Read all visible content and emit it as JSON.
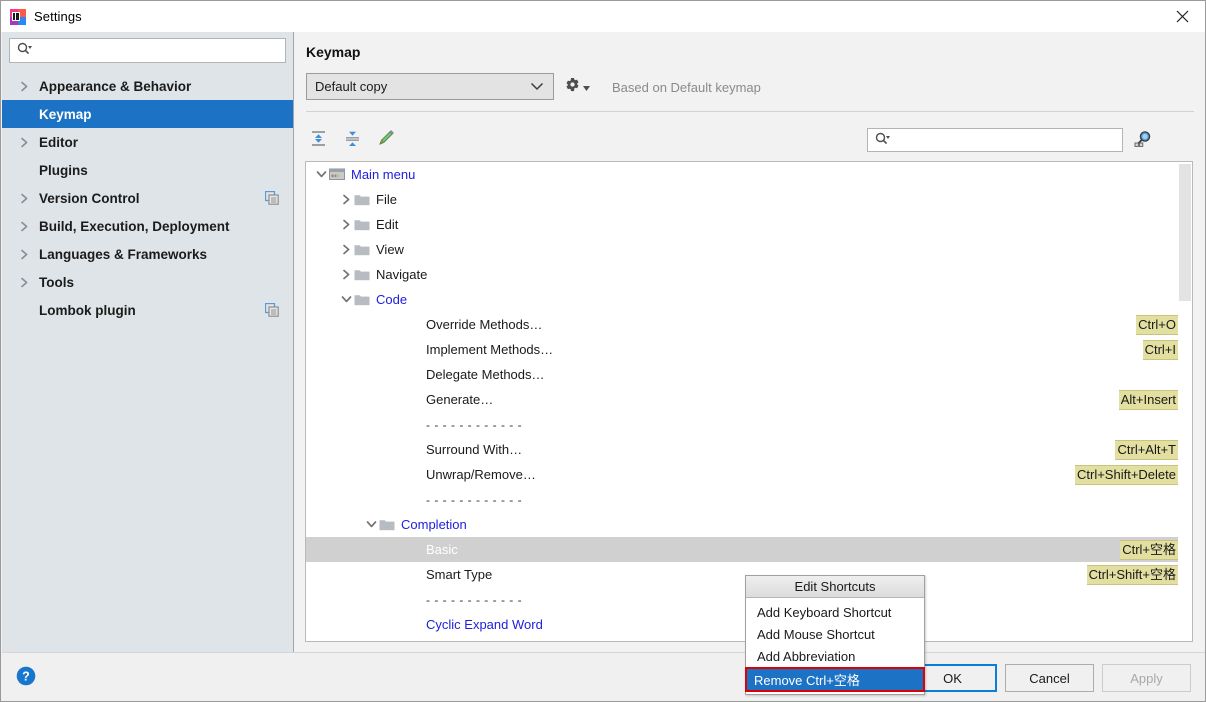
{
  "window": {
    "title": "Settings",
    "app_icon": "intellij-idea-icon",
    "close_icon": "close-icon"
  },
  "sidebar": {
    "search": {
      "placeholder": "",
      "value": "",
      "icon": "search-icon"
    },
    "items": [
      {
        "label": "Appearance & Behavior",
        "expandable": true,
        "selected": false,
        "badge": ""
      },
      {
        "label": "Keymap",
        "expandable": false,
        "selected": true,
        "badge": ""
      },
      {
        "label": "Editor",
        "expandable": true,
        "selected": false,
        "badge": ""
      },
      {
        "label": "Plugins",
        "expandable": false,
        "selected": false,
        "badge": ""
      },
      {
        "label": "Version Control",
        "expandable": true,
        "selected": false,
        "badge": "project-scope-icon"
      },
      {
        "label": "Build, Execution, Deployment",
        "expandable": true,
        "selected": false,
        "badge": ""
      },
      {
        "label": "Languages & Frameworks",
        "expandable": true,
        "selected": false,
        "badge": ""
      },
      {
        "label": "Tools",
        "expandable": true,
        "selected": false,
        "badge": ""
      },
      {
        "label": "Lombok plugin",
        "expandable": false,
        "selected": false,
        "badge": "project-scope-icon"
      }
    ]
  },
  "main": {
    "title": "Keymap",
    "keymap_select": {
      "value": "Default copy",
      "icon": "chevron-down-icon"
    },
    "gear": {
      "icon": "gear-icon",
      "caret": "caret-down-icon"
    },
    "based_on": "Based on Default keymap",
    "toolbar": {
      "expand_all": "expand-all-icon",
      "collapse_all": "collapse-all-icon",
      "edit": "pencil-icon"
    },
    "tree_search": {
      "placeholder": "",
      "value": "",
      "icon": "search-icon"
    },
    "find_shortcut": "find-by-shortcut-icon"
  },
  "tree": [
    {
      "indent": 0,
      "chevron": "down",
      "icon": "main-menu-icon",
      "label": "Main menu",
      "link": true,
      "shortcut": "",
      "selected": false
    },
    {
      "indent": 1,
      "chevron": "right",
      "icon": "folder-icon",
      "label": "File",
      "link": false,
      "shortcut": "",
      "selected": false
    },
    {
      "indent": 1,
      "chevron": "right",
      "icon": "folder-icon",
      "label": "Edit",
      "link": false,
      "shortcut": "",
      "selected": false
    },
    {
      "indent": 1,
      "chevron": "right",
      "icon": "folder-icon",
      "label": "View",
      "link": false,
      "shortcut": "",
      "selected": false
    },
    {
      "indent": 1,
      "chevron": "right",
      "icon": "folder-icon",
      "label": "Navigate",
      "link": false,
      "shortcut": "",
      "selected": false
    },
    {
      "indent": 1,
      "chevron": "down",
      "icon": "folder-icon",
      "label": "Code",
      "link": true,
      "shortcut": "",
      "selected": false
    },
    {
      "indent": 3,
      "chevron": "none",
      "icon": "none",
      "label": "Override Methods…",
      "link": false,
      "shortcut": "Ctrl+O",
      "selected": false
    },
    {
      "indent": 3,
      "chevron": "none",
      "icon": "none",
      "label": "Implement Methods…",
      "link": false,
      "shortcut": "Ctrl+I",
      "selected": false
    },
    {
      "indent": 3,
      "chevron": "none",
      "icon": "none",
      "label": "Delegate Methods…",
      "link": false,
      "shortcut": "",
      "selected": false
    },
    {
      "indent": 3,
      "chevron": "none",
      "icon": "none",
      "label": "Generate…",
      "link": false,
      "shortcut": "Alt+Insert",
      "selected": false
    },
    {
      "indent": 3,
      "chevron": "none",
      "icon": "none",
      "label": "- - - - - - - - - - - -",
      "separator": true,
      "link": false,
      "shortcut": "",
      "selected": false
    },
    {
      "indent": 3,
      "chevron": "none",
      "icon": "none",
      "label": "Surround With…",
      "link": false,
      "shortcut": "Ctrl+Alt+T",
      "selected": false
    },
    {
      "indent": 3,
      "chevron": "none",
      "icon": "none",
      "label": "Unwrap/Remove…",
      "link": false,
      "shortcut": "Ctrl+Shift+Delete",
      "selected": false
    },
    {
      "indent": 3,
      "chevron": "none",
      "icon": "none",
      "label": "- - - - - - - - - - - -",
      "separator": true,
      "link": false,
      "shortcut": "",
      "selected": false
    },
    {
      "indent": 2,
      "chevron": "down",
      "icon": "folder-icon",
      "label": "Completion",
      "link": true,
      "shortcut": "",
      "selected": false
    },
    {
      "indent": 3,
      "chevron": "none",
      "icon": "none",
      "label": "Basic",
      "link": false,
      "shortcut": "Ctrl+空格",
      "selected": true
    },
    {
      "indent": 3,
      "chevron": "none",
      "icon": "none",
      "label": "Smart Type",
      "link": false,
      "shortcut": "Ctrl+Shift+空格",
      "selected": false
    },
    {
      "indent": 3,
      "chevron": "none",
      "icon": "none",
      "label": "- - - - - - - - - - - -",
      "separator": true,
      "link": false,
      "shortcut": "",
      "selected": false
    },
    {
      "indent": 3,
      "chevron": "none",
      "icon": "none",
      "label": "Cyclic Expand Word",
      "link": true,
      "shortcut": "",
      "selected": false
    }
  ],
  "context_menu": {
    "title": "Edit Shortcuts",
    "items": [
      {
        "label": "Add Keyboard Shortcut",
        "highlight": false
      },
      {
        "label": "Add Mouse Shortcut",
        "highlight": false
      },
      {
        "label": "Add Abbreviation",
        "highlight": false
      },
      {
        "label": "Remove Ctrl+空格",
        "highlight": true
      }
    ]
  },
  "footer": {
    "help_icon": "help-icon",
    "ok": "OK",
    "cancel": "Cancel",
    "apply": "Apply"
  },
  "colors": {
    "selection_blue": "#1c72c4",
    "shortcut_yellow": "#e2dfa0",
    "link_blue": "#2020dd",
    "highlight_red": "#e00000",
    "sidebar_bg": "#dfe4e8"
  }
}
